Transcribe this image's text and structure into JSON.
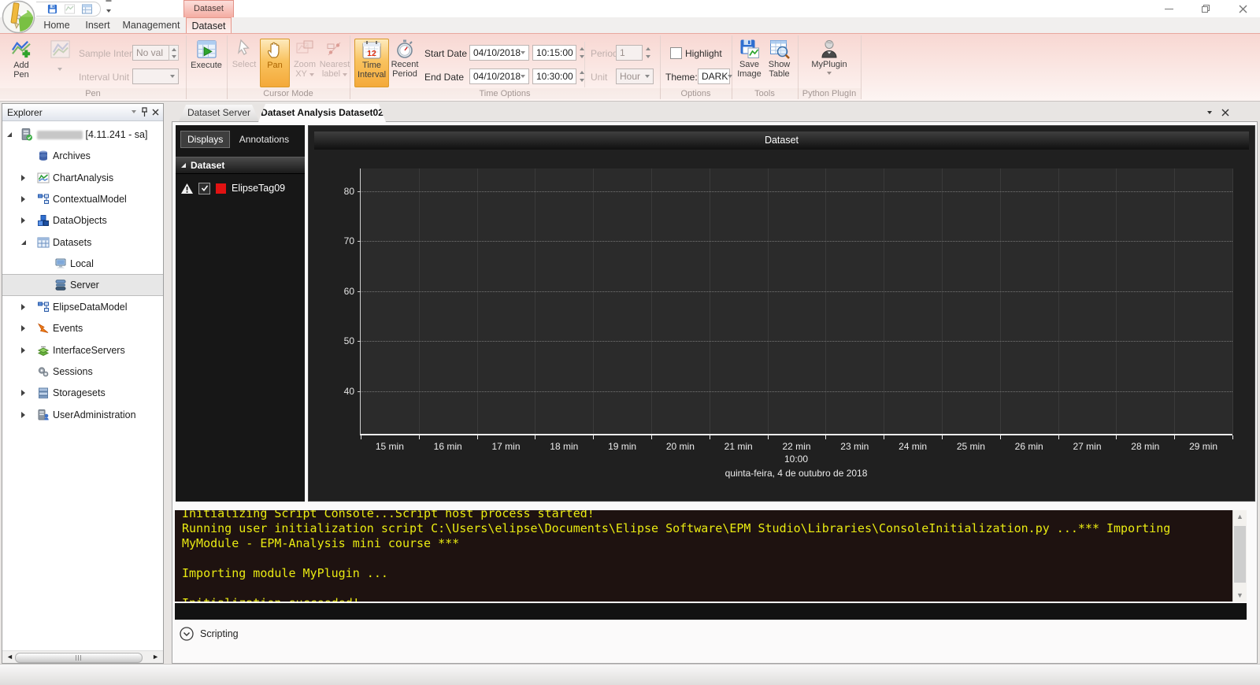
{
  "window": {
    "buttons": {
      "minimize": "minimize",
      "restore": "restore",
      "close": "close"
    }
  },
  "icons": {
    "app-logo": "pencil-gauge-circle",
    "qat-save-icon": "floppy-disk",
    "qat-chart-icon": "line-chart",
    "qat-grid-icon": "table-window",
    "qat-more-icon": "chevron-down",
    "minimize-icon": "horizontal-bar",
    "restore-icon": "overlapping-squares",
    "close-icon": "x-cross",
    "add-pen-icon": "line-chart-plus",
    "pen-dropdown-icon": "line-chart-gray",
    "execute-icon": "table-green-play",
    "select-icon": "cursor-arrow",
    "pan-icon": "hand",
    "zoom-xy-icon": "zoom-rectangle",
    "nearest-label-icon": "points-with-label",
    "time-interval-icon": "calendar-12",
    "recent-period-icon": "stopwatch",
    "save-image-icon": "floppy-with-chart",
    "show-table-icon": "table-with-magnifier",
    "myplugin-icon": "person-silhouette",
    "explorer-dropdown-icon": "chevron-down",
    "explorer-pin-icon": "pin",
    "explorer-close-icon": "x-cross",
    "warning-icon": "warning-triangle",
    "pen-color-swatch": "red-square",
    "scripting-expander-icon": "circled-chevron-down"
  },
  "ribbon": {
    "contextual_header": "Dataset",
    "tabs": [
      {
        "label": "Home",
        "active": false
      },
      {
        "label": "Insert",
        "active": false
      },
      {
        "label": "Management",
        "active": false
      },
      {
        "label": "Dataset",
        "active": true
      }
    ],
    "pen": {
      "add_pen": "Add Pen",
      "sample_interval_label": "Sample Interval",
      "sample_interval_value": "No val",
      "interval_unit_label": "Interval Unit",
      "interval_unit_value": "",
      "group_label": "Pen"
    },
    "execute_label": "Execute",
    "cursor_mode": {
      "select": "Select",
      "pan": "Pan",
      "zoom_xy": "Zoom XY",
      "nearest_label": "Nearest label",
      "group_label": "Cursor Mode"
    },
    "time_options": {
      "time_interval": "Time Interval",
      "recent_period": "Recent Period",
      "start_date_label": "Start Date",
      "start_date_value": "04/10/2018",
      "start_time_value": "10:15:00",
      "end_date_label": "End Date",
      "end_date_value": "04/10/2018",
      "end_time_value": "10:30:00",
      "period_label": "Period",
      "period_value": "1",
      "unit_label": "Unit",
      "unit_value": "Hour",
      "group_label": "Time Options"
    },
    "options": {
      "highlight_label": "Highlight",
      "highlight_checked": false,
      "theme_label": "Theme:",
      "theme_value": "DARK",
      "group_label": "Options"
    },
    "tools": {
      "save_image": "Save Image",
      "show_table": "Show Table",
      "group_label": "Tools"
    },
    "python_plugin": {
      "myplugin": "MyPlugin",
      "group_label": "Python PlugIn"
    }
  },
  "explorer": {
    "title": "Explorer",
    "items": [
      {
        "label": "[4.11.241 - sa]",
        "icon": "server-icon",
        "level": 0,
        "expander": "expanded",
        "redacted_name": true
      },
      {
        "label": "Archives",
        "icon": "archives-icon",
        "level": 1,
        "expander": null
      },
      {
        "label": "ChartAnalysis",
        "icon": "chart-analysis-icon",
        "level": 1,
        "expander": "collapsed"
      },
      {
        "label": "ContextualModel",
        "icon": "contextual-model-icon",
        "level": 1,
        "expander": "collapsed"
      },
      {
        "label": "DataObjects",
        "icon": "data-objects-icon",
        "level": 1,
        "expander": "collapsed"
      },
      {
        "label": "Datasets",
        "icon": "datasets-icon",
        "level": 1,
        "expander": "expanded"
      },
      {
        "label": "Local",
        "icon": "local-icon",
        "level": 2,
        "expander": null
      },
      {
        "label": "Server",
        "icon": "server-stack-icon",
        "level": 2,
        "expander": null,
        "selected": true
      },
      {
        "label": "ElipseDataModel",
        "icon": "contextual-model-icon",
        "level": 1,
        "expander": "collapsed"
      },
      {
        "label": "Events",
        "icon": "events-icon",
        "level": 1,
        "expander": "collapsed"
      },
      {
        "label": "InterfaceServers",
        "icon": "interface-servers-icon",
        "level": 1,
        "expander": "collapsed"
      },
      {
        "label": "Sessions",
        "icon": "sessions-icon",
        "level": 1,
        "expander": null
      },
      {
        "label": "Storagesets",
        "icon": "storagesets-icon",
        "level": 1,
        "expander": "collapsed"
      },
      {
        "label": "UserAdministration",
        "icon": "user-administration-icon",
        "level": 1,
        "expander": "collapsed"
      }
    ]
  },
  "main": {
    "tabs": [
      {
        "label": "Dataset Server",
        "active": false
      },
      {
        "label": "Dataset Analysis Dataset02",
        "active": true
      }
    ]
  },
  "panel": {
    "tabs": {
      "displays": "Displays",
      "annotations": "Annotations"
    },
    "group_label": "Dataset",
    "pens": [
      {
        "label": "ElipseTag09",
        "color": "#e11212",
        "checked": true,
        "warning": true
      }
    ]
  },
  "chart_data": {
    "type": "line",
    "title": "Dataset",
    "x_tick_labels": [
      "15 min",
      "16 min",
      "17 min",
      "18 min",
      "19 min",
      "20 min",
      "21 min",
      "22 min",
      "23 min",
      "24 min",
      "25 min",
      "26 min",
      "27 min",
      "28 min",
      "29 min"
    ],
    "y_ticks": [
      40,
      50,
      60,
      70,
      80
    ],
    "ylim": [
      31.4,
      84.6
    ],
    "x_center_time": "10:00",
    "x_axis_date": "quinta-feira, 4 de outubro de 2018",
    "grid": true,
    "legend_position": "none",
    "series": [
      {
        "name": "ElipseTag09",
        "color": "#e11212",
        "values": []
      }
    ]
  },
  "console": {
    "lines": [
      "Initializing Script Console...Script host process started!",
      "Running user initialization script C:\\Users\\elipse\\Documents\\Elipse Software\\EPM Studio\\Libraries\\ConsoleInitialization.py ...*** Importing",
      "MyModule - EPM-Analysis mini course ***",
      "",
      "Importing module MyPlugin ...",
      "",
      "Initialization succeeded!"
    ]
  },
  "scripting": {
    "label": "Scripting"
  },
  "colors": {
    "accent_orange": "#f4a93a",
    "contextual_pink": "#f4aca2",
    "console_text": "#e9ea12",
    "console_bg": "#1e1210",
    "pen_red": "#e11212",
    "chart_bg": "#2b2b2b",
    "panel_dark": "#171717"
  }
}
